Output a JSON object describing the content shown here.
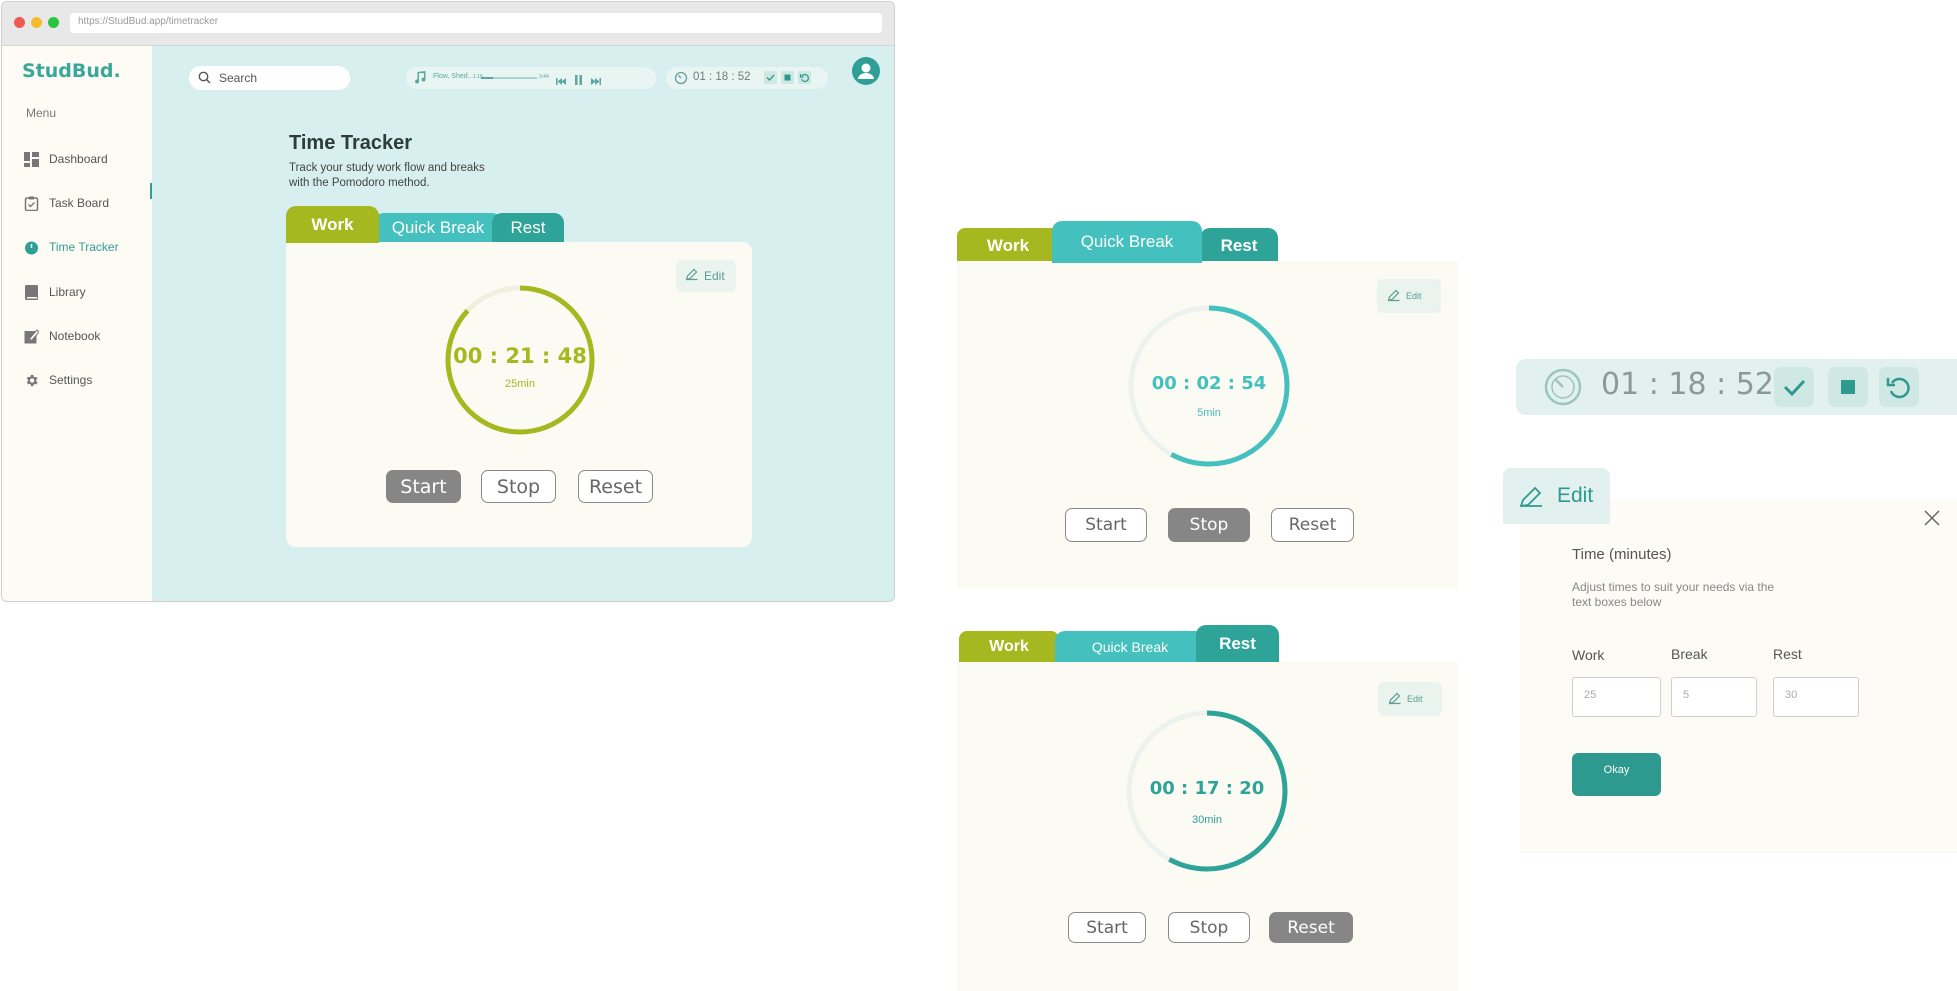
{
  "browser": {
    "url": "https://StudBud.app/timetracker"
  },
  "sidebar": {
    "logo": "StudBud.",
    "menu_label": "Menu",
    "items": [
      {
        "label": "Dashboard",
        "icon": "dashboard-icon"
      },
      {
        "label": "Task Board",
        "icon": "clipboard-icon"
      },
      {
        "label": "Time Tracker",
        "icon": "stopwatch-icon",
        "active": true
      },
      {
        "label": "Library",
        "icon": "book-icon"
      },
      {
        "label": "Notebook",
        "icon": "notebook-icon"
      },
      {
        "label": "Settings",
        "icon": "gear-icon"
      }
    ]
  },
  "header": {
    "search_placeholder": "Search",
    "player": {
      "track": "Flow, Shed...",
      "elapsed": "1:16",
      "total": "3:44",
      "progress": 0.22
    },
    "mini_timer": {
      "time": "01 : 18 : 52"
    }
  },
  "page": {
    "title": "Time Tracker",
    "subtitle": "Track your study work flow and breaks with the Pomodoro method."
  },
  "tabs": {
    "work": "Work",
    "quick_break": "Quick Break",
    "rest": "Rest"
  },
  "buttons": {
    "start": "Start",
    "stop": "Stop",
    "reset": "Reset",
    "edit": "Edit"
  },
  "timers": {
    "main": {
      "time": "00 : 21 : 48",
      "duration": "25min",
      "active_tab": "work",
      "active_button": "start",
      "progress": 0.87,
      "color": "#a6b81f"
    },
    "quick_break": {
      "time": "00 : 02 : 54",
      "duration": "5min",
      "active_tab": "quick_break",
      "active_button": "stop",
      "progress": 0.58,
      "color": "#44c0be"
    },
    "rest": {
      "time": "00 : 17 : 20",
      "duration": "30min",
      "active_tab": "rest",
      "active_button": "reset",
      "progress": 0.58,
      "color": "#2ea397"
    }
  },
  "big_timer": {
    "time": "01 : 18 : 52"
  },
  "edit_panel": {
    "tab_label": "Edit",
    "heading": "Time (minutes)",
    "description": "Adjust times to suit your needs via the text boxes below",
    "fields": [
      {
        "label": "Work",
        "value": "25"
      },
      {
        "label": "Break",
        "value": "5"
      },
      {
        "label": "Rest",
        "value": "30"
      }
    ],
    "okay": "Okay"
  },
  "colors": {
    "work": "#a6b81f",
    "quick_break": "#44c0be",
    "rest": "#2ea397",
    "main_bg": "#d8efef"
  }
}
